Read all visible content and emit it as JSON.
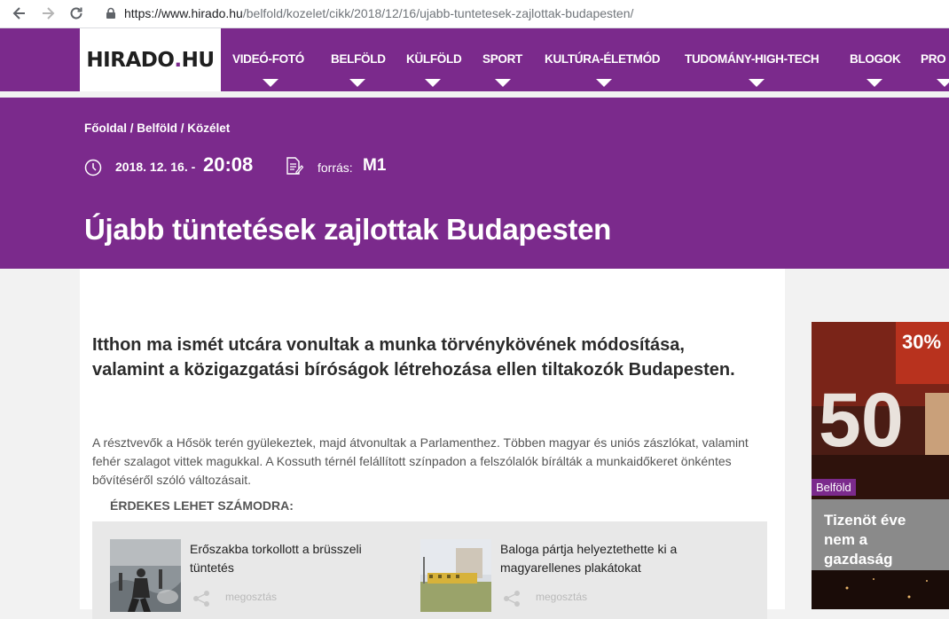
{
  "browser": {
    "url_host": "https://www.hirado.hu",
    "url_path": "/belfold/kozelet/cikk/2018/12/16/ujabb-tuntetesek-zajlottak-budapesten/"
  },
  "header": {
    "logo_main": "HIRADO",
    "logo_dot": ".",
    "logo_tld": "HU",
    "menu": [
      {
        "label": "VIDEÓ-FOTÓ"
      },
      {
        "label": "BELFÖLD"
      },
      {
        "label": "KÜLFÖLD"
      },
      {
        "label": "SPORT"
      },
      {
        "label": "KULTÚRA-ÉLETMÓD"
      },
      {
        "label": "TUDOMÁNY-HIGH-TECH"
      },
      {
        "label": "BLOGOK"
      },
      {
        "label": "PRO"
      }
    ]
  },
  "hero": {
    "breadcrumb": "Főoldal / Belföld / Közélet",
    "date": "2018. 12. 16. -",
    "time": "20:08",
    "source_label": "forrás:",
    "source_name": "M1",
    "title": "Újabb tüntetések zajlottak Budapesten"
  },
  "article": {
    "lead": "Itthon ma ismét utcára vonultak a munka törvénykövének módosítása, valamint a közigazgatási bíróságok létrehozása ellen tiltakozók Budapesten.",
    "body": "A résztvevők a Hősök terén gyülekeztek, majd átvonultak a Parlamenthez. Többen magyar és uniós zászlókat, valamint fehér szalagot vittek magukkal. A Kossuth térnél felállított színpadon a felszólalók bírálták a munkaidőkeret önkéntes bővítéséről szóló változásait.",
    "related_heading": "ÉRDEKES LEHET SZÁMODRA:",
    "related": [
      {
        "title": "Erőszakba torkollott a brüsszeli tüntetés",
        "share": "megosztás"
      },
      {
        "title": "Baloga pártja helyeztethette ki a magyarellenes plakátokat",
        "share": "megosztás"
      }
    ]
  },
  "side": {
    "badge": "Belföld",
    "title": "Tizenöt éve nem a gazdaság",
    "img_text_1": "30%",
    "img_text_2": "50"
  },
  "colors": {
    "brand_purple": "#7b2a8c"
  }
}
